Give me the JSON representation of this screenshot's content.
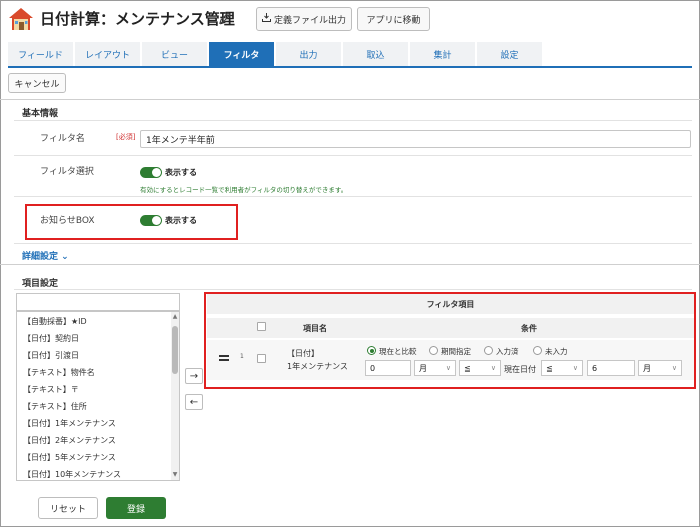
{
  "header": {
    "title": "日付計算：メンテナンス管理",
    "export_label": "定義ファイル出力",
    "move_label": "アプリに移動"
  },
  "tabs": [
    {
      "label": "フィールド"
    },
    {
      "label": "レイアウト"
    },
    {
      "label": "ビュー"
    },
    {
      "label": "フィルタ"
    },
    {
      "label": "出力"
    },
    {
      "label": "取込"
    },
    {
      "label": "集計"
    },
    {
      "label": "設定"
    }
  ],
  "active_tab": "フィルタ",
  "cancel_label": "キャンセル",
  "basic": {
    "section_title": "基本情報",
    "filter_name_label": "フィルタ名",
    "required_label": "[必須]",
    "filter_name_value": "1年メンテ半年前",
    "filter_select_label": "フィルタ選択",
    "filter_select_toggle": "表示する",
    "filter_select_hint": "有効にするとレコード一覧で利用者がフィルタの切り替えができます。",
    "notice_label": "お知らせBOX",
    "notice_toggle": "表示する"
  },
  "detail_label": "詳細設定",
  "items": {
    "section_title": "項目設定",
    "list": [
      "【自動採番】★ID",
      "【日付】契約日",
      "【日付】引渡日",
      "【テキスト】物件名",
      "【テキスト】〒",
      "【テキスト】住所",
      "【日付】1年メンテナンス",
      "【日付】2年メンテナンス",
      "【日付】5年メンテナンス",
      "【日付】10年メンテナンス"
    ]
  },
  "filter_table": {
    "title": "フィルタ項目",
    "col_item": "項目名",
    "col_condition": "条件",
    "row": {
      "number": "1",
      "item_line1": "【日付】",
      "item_line2": "1年メンテナンス",
      "radios": [
        "現在と比較",
        "期間指定",
        "入力済",
        "未入力"
      ],
      "selected_radio": "現在と比較",
      "offset_value": "0",
      "unit1": "月",
      "op1": "≦",
      "current_date_label": "現在日付",
      "op2": "≦",
      "value2": "6",
      "unit2": "月"
    }
  },
  "buttons": {
    "reset": "リセット",
    "save": "登録"
  },
  "colors": {
    "accent": "#1f6fb7",
    "green": "#2e7d32",
    "highlight": "#e02020"
  }
}
